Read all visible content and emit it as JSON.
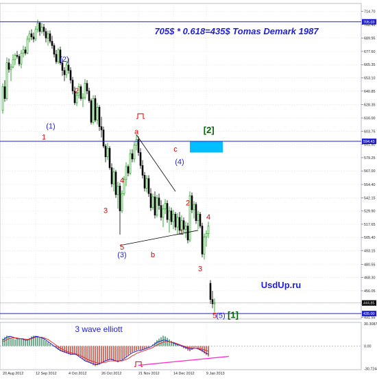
{
  "title": "705$ * 0.618=435$ Tomas Demark 1987",
  "watermark": "UsdUp.ru",
  "indicator_label": "3 wave elliott",
  "colors": {
    "background": "#ffffff",
    "grid": "#d7dbe6",
    "bull_candle": "#009900",
    "bear_candle": "#000000",
    "level_line": "#1f1fd6",
    "target_box": "#00bfff",
    "title": "#1f1fd6",
    "red_label": "#dd0000",
    "blue_label": "#1f1fd6",
    "green_label": "#006600",
    "trendline": "#000000",
    "divergence_line": "#ff33cc",
    "macd_pos": "#2e8b57",
    "macd_neg": "#c0392b",
    "signal_blue": "#1f1fd6",
    "signal_red": "#e03030",
    "price_tag": "#1f1fd6"
  },
  "chart_data": {
    "type": "candlestick",
    "y_axis": {
      "range": [
        430,
        722
      ],
      "ticks": [
        "714.70",
        "702.45",
        "689.95",
        "677.60",
        "665.35",
        "653.10",
        "640.85",
        "628.35",
        "616.00",
        "603.75",
        "591.50",
        "579.25",
        "567.00",
        "554.40",
        "542.15",
        "529.90",
        "517.65",
        "505.40",
        "493.15",
        "480.55",
        "468.30",
        "456.05",
        "443.80",
        "431.55"
      ]
    },
    "x_axis": {
      "ticks": [
        "20 Aug 2012",
        "12 Sep 2012",
        "4 Oct 2012",
        "26 Oct 2012",
        "21 Nov 2012",
        "14 Dec 2012",
        "9 Jan 2013"
      ]
    },
    "horizontal_levels": [
      {
        "value": 705.0,
        "label": "705.03"
      },
      {
        "value": 594.4,
        "label": "594.43"
      },
      {
        "value": 435.0,
        "label": "435.00"
      }
    ],
    "price_tags": [
      {
        "value": 444.8,
        "label": "444.85"
      }
    ],
    "target_zone": {
      "label": "[2]",
      "price_top": 594.4,
      "price_bottom": 584.0,
      "time_start": "27 Dec 2012",
      "time_end": "22 Jan 2013"
    },
    "trendlines": [
      {
        "from": [
          "20 Nov 2012",
          600.5
        ],
        "to": [
          "17 Dec 2012",
          548.0
        ]
      },
      {
        "from": [
          "8 Nov 2012",
          498.0
        ],
        "to": [
          "3 Jan 2013",
          512.0
        ]
      }
    ],
    "ohlc": [
      [
        "20 Aug 2012",
        623,
        648,
        620,
        645
      ],
      [
        "21 Aug 2012",
        645,
        651,
        631,
        634
      ],
      [
        "22 Aug 2012",
        634,
        672,
        632,
        667
      ],
      [
        "23 Aug 2012",
        667,
        671,
        658,
        661
      ],
      [
        "24 Aug 2012",
        661,
        666,
        650,
        663
      ],
      [
        "27 Aug 2012",
        663,
        675,
        662,
        670
      ],
      [
        "28 Aug 2012",
        670,
        676,
        665,
        674
      ],
      [
        "29 Aug 2012",
        674,
        678,
        671,
        673
      ],
      [
        "30 Aug 2012",
        673,
        675,
        664,
        666
      ],
      [
        "31 Aug 2012",
        666,
        679,
        662,
        676
      ],
      [
        "4 Sep 2012",
        676,
        683,
        672,
        679
      ],
      [
        "5 Sep 2012",
        679,
        682,
        674,
        676
      ],
      [
        "6 Sep 2012",
        676,
        692,
        675,
        689
      ],
      [
        "7 Sep 2012",
        689,
        697,
        686,
        694
      ],
      [
        "10 Sep 2012",
        694,
        698,
        688,
        691
      ],
      [
        "11 Sep 2012",
        691,
        695,
        686,
        689
      ],
      [
        "12 Sep 2012",
        689,
        701,
        687,
        698
      ],
      [
        "13 Sep 2012",
        698,
        707,
        695,
        704
      ],
      [
        "14 Sep 2012",
        704,
        705,
        692,
        696
      ],
      [
        "17 Sep 2012",
        696,
        704,
        694,
        700
      ],
      [
        "18 Sep 2012",
        700,
        703,
        692,
        696
      ],
      [
        "19 Sep 2012",
        696,
        699,
        686,
        690
      ],
      [
        "20 Sep 2012",
        690,
        697,
        683,
        694
      ],
      [
        "21 Sep 2012",
        694,
        697,
        685,
        687
      ],
      [
        "24 Sep 2012",
        687,
        692,
        680,
        683
      ],
      [
        "25 Sep 2012",
        683,
        685,
        672,
        675
      ],
      [
        "26 Sep 2012",
        675,
        679,
        666,
        668
      ],
      [
        "27 Sep 2012",
        668,
        681,
        666,
        679
      ],
      [
        "28 Sep 2012",
        679,
        682,
        665,
        667
      ],
      [
        "1 Oct 2012",
        667,
        671,
        655,
        660
      ],
      [
        "2 Oct 2012",
        660,
        663,
        650,
        656
      ],
      [
        "3 Oct 2012",
        656,
        669,
        653,
        665
      ],
      [
        "4 Oct 2012",
        665,
        671,
        657,
        660
      ],
      [
        "5 Oct 2012",
        660,
        663,
        648,
        651
      ],
      [
        "8 Oct 2012",
        651,
        654,
        638,
        641
      ],
      [
        "9 Oct 2012",
        641,
        645,
        628,
        630
      ],
      [
        "10 Oct 2012",
        630,
        640,
        627,
        637
      ],
      [
        "11 Oct 2012",
        637,
        648,
        634,
        645
      ],
      [
        "12 Oct 2012",
        645,
        647,
        632,
        634
      ],
      [
        "15 Oct 2012",
        634,
        639,
        626,
        635
      ],
      [
        "16 Oct 2012",
        635,
        652,
        633,
        648
      ],
      [
        "17 Oct 2012",
        648,
        651,
        638,
        641
      ],
      [
        "18 Oct 2012",
        641,
        644,
        630,
        632
      ],
      [
        "19 Oct 2012",
        632,
        634,
        610,
        612
      ],
      [
        "22 Oct 2012",
        612,
        637,
        610,
        634
      ],
      [
        "23 Oct 2012",
        634,
        637,
        612,
        614
      ],
      [
        "24 Oct 2012",
        614,
        630,
        610,
        626
      ],
      [
        "25 Oct 2012",
        626,
        628,
        604,
        608
      ],
      [
        "26 Oct 2012",
        608,
        617,
        598,
        605
      ],
      [
        "29 Oct 2012",
        605,
        608,
        588,
        590
      ],
      [
        "30 Oct 2012",
        590,
        592,
        575,
        580
      ],
      [
        "31 Oct 2012",
        580,
        593,
        577,
        588
      ],
      [
        "1 Nov 2012",
        588,
        590,
        568,
        570
      ],
      [
        "2 Nov 2012",
        570,
        574,
        552,
        555
      ],
      [
        "5 Nov 2012",
        555,
        570,
        548,
        566
      ],
      [
        "6 Nov 2012",
        566,
        568,
        542,
        545
      ],
      [
        "7 Nov 2012",
        545,
        557,
        532,
        553
      ],
      [
        "8 Nov 2012",
        553,
        556,
        508,
        530
      ],
      [
        "9 Nov 2012",
        530,
        549,
        528,
        546
      ],
      [
        "12 Nov 2012",
        546,
        562,
        544,
        559
      ],
      [
        "13 Nov 2012",
        559,
        575,
        553,
        571
      ],
      [
        "14 Nov 2012",
        571,
        573,
        562,
        565
      ],
      [
        "15 Nov 2012",
        565,
        587,
        563,
        583
      ],
      [
        "16 Nov 2012",
        583,
        587,
        575,
        578
      ],
      [
        "19 Nov 2012",
        578,
        594,
        575,
        591
      ],
      [
        "20 Nov 2012",
        591,
        600,
        586,
        596
      ],
      [
        "21 Nov 2012",
        596,
        599,
        581,
        584
      ],
      [
        "22 Nov 2012",
        584,
        588,
        569,
        572
      ],
      [
        "23 Nov 2012",
        572,
        577,
        560,
        563
      ],
      [
        "26 Nov 2012",
        563,
        566,
        548,
        551
      ],
      [
        "27 Nov 2012",
        551,
        563,
        547,
        560
      ],
      [
        "28 Nov 2012",
        560,
        563,
        543,
        546
      ],
      [
        "29 Nov 2012",
        546,
        551,
        530,
        533
      ],
      [
        "30 Nov 2012",
        533,
        546,
        531,
        543
      ],
      [
        "3 Dec 2012",
        543,
        548,
        523,
        526
      ],
      [
        "4 Dec 2012",
        526,
        545,
        524,
        542
      ],
      [
        "5 Dec 2012",
        542,
        546,
        531,
        535
      ],
      [
        "6 Dec 2012",
        535,
        540,
        521,
        524
      ],
      [
        "7 Dec 2012",
        524,
        536,
        515,
        532
      ],
      [
        "10 Dec 2012",
        532,
        541,
        527,
        537
      ],
      [
        "11 Dec 2012",
        537,
        540,
        519,
        522
      ],
      [
        "12 Dec 2012",
        522,
        534,
        510,
        530
      ],
      [
        "13 Dec 2012",
        530,
        533,
        517,
        520
      ],
      [
        "14 Dec 2012",
        520,
        531,
        513,
        527
      ],
      [
        "17 Dec 2012",
        527,
        529,
        512,
        515
      ],
      [
        "18 Dec 2012",
        515,
        528,
        508,
        524
      ],
      [
        "19 Dec 2012",
        524,
        529,
        508,
        512
      ],
      [
        "20 Dec 2012",
        512,
        526,
        509,
        521
      ],
      [
        "21 Dec 2012",
        521,
        524,
        510,
        513
      ],
      [
        "24 Dec 2012",
        513,
        520,
        505,
        516
      ],
      [
        "26 Dec 2012",
        516,
        519,
        500,
        503
      ],
      [
        "27 Dec 2012",
        503,
        548,
        501,
        544
      ],
      [
        "28 Dec 2012",
        544,
        547,
        528,
        531
      ],
      [
        "31 Dec 2012",
        531,
        539,
        523,
        536
      ],
      [
        "2 Jan 2013",
        536,
        538,
        518,
        521
      ],
      [
        "3 Jan 2013",
        521,
        530,
        513,
        527
      ],
      [
        "4 Jan 2013",
        527,
        529,
        514,
        516
      ],
      [
        "7 Jan 2013",
        516,
        519,
        487,
        490
      ],
      [
        "8 Jan 2013",
        490,
        509,
        485,
        506
      ],
      [
        "9 Jan 2013",
        506,
        512,
        497,
        509
      ],
      [
        "10 Jan 2013",
        509,
        520,
        505,
        516
      ],
      [
        "14 Jan 2013",
        463,
        466,
        444,
        448
      ],
      [
        "15 Jan 2013",
        448,
        456,
        440,
        444
      ],
      [
        "16 Jan 2013",
        444,
        449,
        436,
        445
      ]
    ],
    "annotations": [
      {
        "text": "(2)",
        "color": "blue",
        "date": "2 Oct 2012",
        "price": 668
      },
      {
        "text": "2",
        "color": "red",
        "date": "10 Oct 2012",
        "price": 639
      },
      {
        "text": "(1)",
        "color": "blue",
        "date": "22 Sep 2012",
        "price": 606
      },
      {
        "text": "1",
        "color": "red",
        "date": "18 Sep 2012",
        "price": 596
      },
      {
        "text": "a",
        "color": "red",
        "date": "20 Nov 2012",
        "price": 601
      },
      {
        "text": "c",
        "color": "red",
        "date": "17 Dec 2012",
        "price": 585
      },
      {
        "text": "(4)",
        "color": "blue",
        "date": "19 Dec 2012",
        "price": 573
      },
      {
        "text": "4",
        "color": "red",
        "date": "9 Nov 2012",
        "price": 556
      },
      {
        "text": "3",
        "color": "red",
        "date": "30 Oct 2012",
        "price": 528
      },
      {
        "text": "2",
        "color": "red",
        "date": "26 Dec 2012",
        "price": 535
      },
      {
        "text": "4",
        "color": "red",
        "date": "10 Jan 2013",
        "price": 522
      },
      {
        "text": "1",
        "color": "red",
        "date": "20 Dec 2012",
        "price": 508
      },
      {
        "text": "5",
        "color": "red",
        "date": "9 Nov 2012",
        "price": 494
      },
      {
        "text": "(3)",
        "color": "blue",
        "date": "9 Nov 2012",
        "price": 487
      },
      {
        "text": "b",
        "color": "red",
        "date": "30 Nov 2012",
        "price": 487
      },
      {
        "text": "3",
        "color": "red",
        "date": "4 Jan 2013",
        "price": 474
      },
      {
        "text": "5",
        "color": "red",
        "date": "16 Jan 2013",
        "price": 431
      },
      {
        "text": "(5)",
        "color": "blue",
        "date": "21 Jan 2013",
        "price": 431
      },
      {
        "text": "[1]",
        "color": "green",
        "date": "29 Jan 2013",
        "price": 431
      },
      {
        "text": "[2]",
        "color": "green",
        "date": "11 Jan 2013",
        "price": 602
      }
    ],
    "fractal_markers": [
      {
        "date": "22 Nov 2012",
        "price": 618
      }
    ],
    "indicator": {
      "name": "MACD",
      "ticks": [
        "30.3087",
        "0.00",
        "-30.7244"
      ],
      "range": [
        -32,
        32
      ],
      "histogram": [
        10,
        12,
        14,
        13,
        11,
        10,
        9,
        10,
        11,
        10,
        9,
        8,
        9,
        11,
        13,
        14,
        14,
        13,
        12,
        11,
        9,
        7,
        5,
        3,
        1,
        -1,
        -3,
        -5,
        -7,
        -8,
        -9,
        -10,
        -11,
        -12,
        -11,
        -10,
        -12,
        -14,
        -16,
        -18,
        -20,
        -21,
        -22,
        -24,
        -26,
        -27,
        -26,
        -25,
        -23,
        -22,
        -20,
        -19,
        -18,
        -19,
        -20,
        -21,
        -22,
        -20,
        -18,
        -16,
        -14,
        -12,
        -10,
        -8,
        -7,
        -6,
        -5,
        -6,
        -5,
        -4,
        -3,
        -2,
        0,
        2,
        5,
        8,
        10,
        12,
        14,
        13,
        11,
        9,
        7,
        5,
        3,
        2,
        0,
        -1,
        -3,
        -4,
        -6,
        -7,
        -5,
        -3,
        -2,
        -4,
        -6,
        -8,
        -10,
        -12,
        -14
      ],
      "signal_fast": [
        8,
        10,
        12,
        13,
        13,
        12,
        11,
        10,
        10,
        10,
        9,
        8,
        8,
        9,
        11,
        12,
        13,
        13,
        12,
        11,
        10,
        8,
        6,
        4,
        2,
        0,
        -2,
        -4,
        -6,
        -7,
        -8,
        -9,
        -10,
        -11,
        -11,
        -11,
        -12,
        -14,
        -16,
        -18,
        -20,
        -21,
        -22,
        -23,
        -24,
        -25,
        -25,
        -24,
        -23,
        -21,
        -20,
        -19,
        -18,
        -18,
        -19,
        -20,
        -21,
        -20,
        -19,
        -17,
        -15,
        -13,
        -11,
        -9,
        -8,
        -7,
        -6,
        -6,
        -5,
        -4,
        -3,
        -2,
        -1,
        1,
        3,
        5,
        6,
        7,
        8,
        8,
        7,
        6,
        5,
        4,
        3,
        2,
        1,
        0,
        -1,
        -2,
        -3,
        -4,
        -4,
        -3,
        -3,
        -4,
        -5,
        -6,
        -8,
        -10,
        -11
      ],
      "signal_slow": [
        6,
        7,
        9,
        10,
        11,
        11,
        11,
        11,
        10,
        10,
        10,
        9,
        9,
        9,
        10,
        11,
        12,
        12,
        12,
        12,
        11,
        10,
        9,
        7,
        5,
        3,
        1,
        -1,
        -3,
        -4,
        -6,
        -7,
        -8,
        -9,
        -10,
        -10,
        -11,
        -12,
        -13,
        -15,
        -16,
        -18,
        -19,
        -20,
        -21,
        -22,
        -23,
        -23,
        -23,
        -22,
        -22,
        -21,
        -20,
        -20,
        -20,
        -20,
        -20,
        -20,
        -20,
        -19,
        -18,
        -17,
        -15,
        -13,
        -12,
        -10,
        -9,
        -8,
        -7,
        -6,
        -5,
        -4,
        -3,
        -2,
        0,
        1,
        3,
        4,
        5,
        6,
        6,
        6,
        5,
        5,
        4,
        3,
        2,
        1,
        0,
        -1,
        -2,
        -2,
        -3,
        -3,
        -3,
        -3,
        -4,
        -4,
        -5,
        -6,
        -7
      ],
      "divergence_line": {
        "from": [
          "21 Nov 2012",
          -26
        ],
        "to": [
          "25 Jan 2013",
          -14
        ]
      },
      "fractal_marker": {
        "date": "21 Nov 2012",
        "value": -24
      }
    }
  }
}
